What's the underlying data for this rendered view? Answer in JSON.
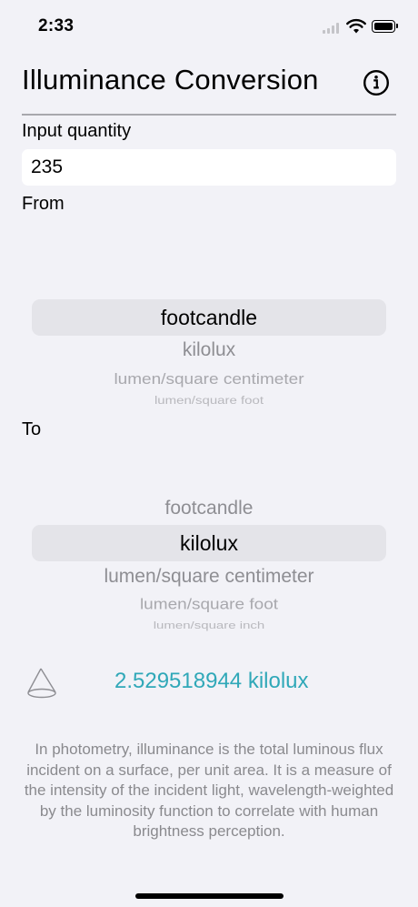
{
  "status": {
    "time": "2:33"
  },
  "header": {
    "title": "Illuminance Conversion"
  },
  "input": {
    "label": "Input quantity",
    "value": "235"
  },
  "from": {
    "label": "From",
    "selected": "footcandle",
    "options_below": [
      "kilolux",
      "lumen/square centimeter",
      "lumen/square foot"
    ]
  },
  "to": {
    "label": "To",
    "option_above": "footcandle",
    "selected": "kilolux",
    "options_below": [
      "lumen/square centimeter",
      "lumen/square foot",
      "lumen/square inch"
    ]
  },
  "result": {
    "text": "2.529518944 kilolux"
  },
  "description": "In photometry, illuminance is the total luminous flux incident on a surface, per unit area. It is a measure of the intensity of the incident light, wavelength-weighted by the luminosity function to correlate with human brightness perception.",
  "colors": {
    "accent": "#30a8b8",
    "background": "#f2f2f7"
  }
}
